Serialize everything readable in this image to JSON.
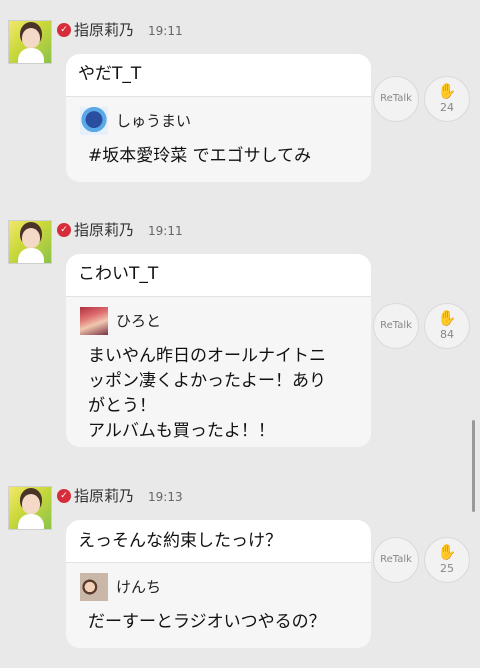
{
  "posts": [
    {
      "author": "指原莉乃",
      "time": "19:11",
      "text": "やだT_T",
      "quote": {
        "user": "しゅうまい",
        "text": "#坂本愛玲菜 でエゴサしてみ"
      },
      "retalk": "ReTalk",
      "claps": "24"
    },
    {
      "author": "指原莉乃",
      "time": "19:11",
      "text": "こわいT_T",
      "quote": {
        "user": "ひろと",
        "text": "まいやん昨日のオールナイトニッポン凄くよかったよー！ありがとう！\nアルバムも買ったよ！！"
      },
      "retalk": "ReTalk",
      "claps": "84"
    },
    {
      "author": "指原莉乃",
      "time": "19:13",
      "text": "えっそんな約束したっけ？",
      "quote": {
        "user": "けんち",
        "text": "だーすーとラジオいつやるの？"
      },
      "retalk": "ReTalk",
      "claps": "25"
    }
  ],
  "icons": {
    "verified": "verified-badge-icon",
    "clap": "clap-hands-icon"
  },
  "colors": {
    "background": "#e9e9e9",
    "verified": "#d62d3a"
  }
}
